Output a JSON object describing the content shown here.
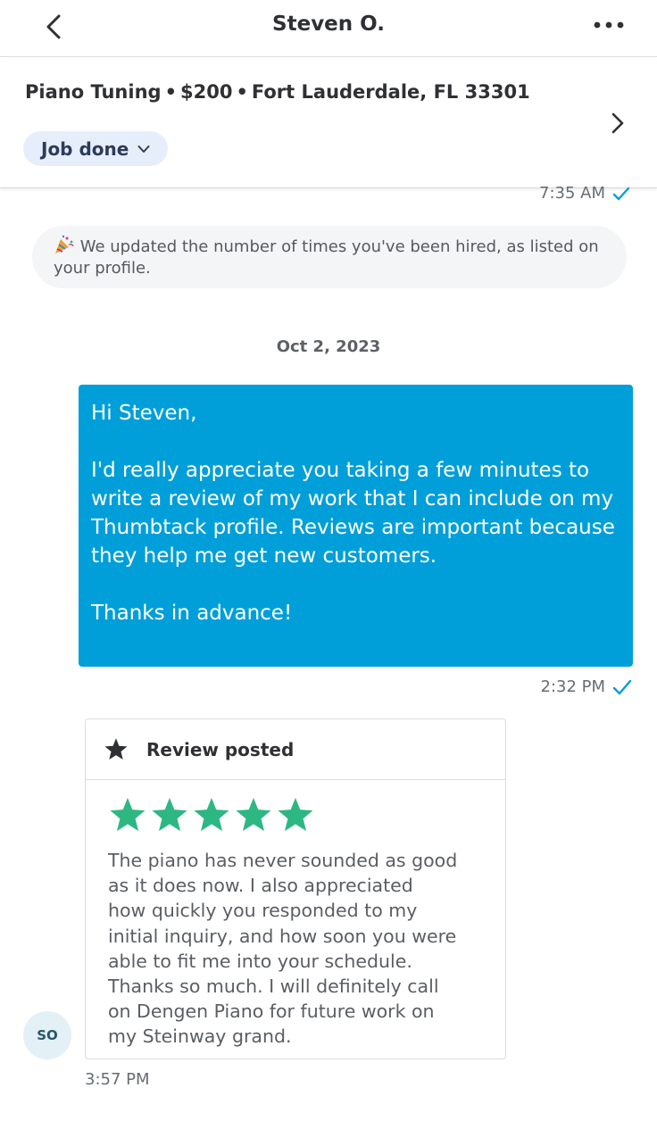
{
  "nav": {
    "title": "Steven O.",
    "back_icon": "chevron-left-icon",
    "more_icon": "ellipsis-icon"
  },
  "job": {
    "service": "Piano Tuning",
    "price": "$200",
    "location": "Fort Lauderdale, FL 33301",
    "separator": "•",
    "status": "Job done",
    "status_bg": "#e6eefb"
  },
  "messages": {
    "top_time": "7:35 AM",
    "system_note": "We updated the number of times you've been hired, as listed on your profile.",
    "system_icon": "party-popper-icon",
    "date": "Oct 2, 2023",
    "sent": {
      "greeting": "Hi Steven,",
      "body": "I'd really appreciate you taking a few minutes to write a review of my work that I can include on my Thumbtack profile. Reviews are important because they help me get new customers.",
      "closing": "Thanks in advance!",
      "time": "2:32 PM",
      "bubble_color": "#009fd9"
    },
    "review": {
      "title": "Review posted",
      "rating": 5,
      "star_color": "#2db783",
      "text": "The piano has never sounded as good\nas it does now.  I also appreciated\nhow quickly you responded to my\ninitial inquiry, and how soon you were\nable to fit me into your schedule.\nThanks so much.  I will definitely call\non Dengen Piano for future work on\nmy Steinway grand.",
      "time": "3:57 PM",
      "avatar_initials": "SO"
    }
  }
}
